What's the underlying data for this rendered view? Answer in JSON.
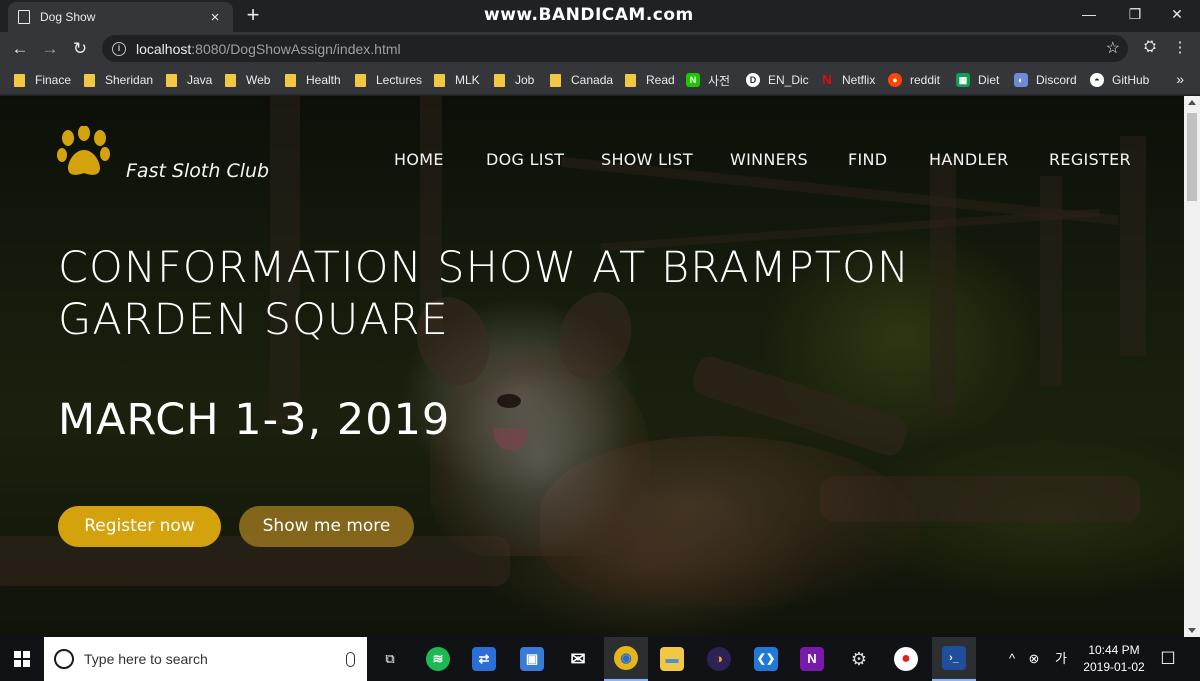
{
  "browser": {
    "tab_title": "Dog Show",
    "tab_close": "×",
    "new_tab": "+",
    "watermark": "www.BANDICAM.com",
    "window_controls": {
      "minimize": "—",
      "restore": "❐",
      "close": "✕"
    },
    "nav": {
      "back": "←",
      "forward": "→",
      "reload": "↻"
    },
    "url_host": "localhost",
    "url_rest": ":8080/DogShowAssign/index.html",
    "star": "☆",
    "menu": "⋮",
    "bookmarks": [
      {
        "label": "Finace",
        "type": "folder"
      },
      {
        "label": "Sheridan",
        "type": "folder"
      },
      {
        "label": "Java",
        "type": "folder"
      },
      {
        "label": "Web",
        "type": "folder"
      },
      {
        "label": "Health",
        "type": "folder"
      },
      {
        "label": "Lectures",
        "type": "folder"
      },
      {
        "label": "MLK",
        "type": "folder"
      },
      {
        "label": "Job",
        "type": "folder"
      },
      {
        "label": "Canada",
        "type": "folder"
      },
      {
        "label": "Read",
        "type": "folder"
      },
      {
        "label": "사전",
        "type": "site",
        "color": "#1ec800"
      },
      {
        "label": "EN_Dic",
        "type": "site",
        "color": "#ffffff"
      },
      {
        "label": "Netflix",
        "type": "site",
        "color": "#e50914"
      },
      {
        "label": "reddit",
        "type": "site",
        "color": "#ff4500"
      },
      {
        "label": "Diet",
        "type": "site",
        "color": "#0f9d58"
      },
      {
        "label": "Discord",
        "type": "site",
        "color": "#7289da"
      },
      {
        "label": "GitHub",
        "type": "site",
        "color": "#ffffff"
      }
    ],
    "bookmarks_more": "»"
  },
  "page": {
    "brand": "Fast Sloth Club",
    "accent_color": "#d4a20c",
    "nav_items": [
      "HOME",
      "DOG LIST",
      "SHOW LIST",
      "WINNERS",
      "FIND",
      "HANDLER",
      "REGISTER"
    ],
    "headline_line1": "CONFORMATION SHOW AT BRAMPTON",
    "headline_line2": "GARDEN SQUARE",
    "date": "MARCH 1-3, 2019",
    "primary_button": "Register now",
    "secondary_button": "Show me more"
  },
  "taskbar": {
    "search_placeholder": "Type here to search",
    "apps": [
      {
        "name": "task-view",
        "glyph": "⧉",
        "color": "transparent"
      },
      {
        "name": "spotify",
        "glyph": "≋",
        "color": "#1db954"
      },
      {
        "name": "network",
        "glyph": "⇄",
        "color": "#2b6fd6"
      },
      {
        "name": "remote",
        "glyph": "▣",
        "color": "#3a7bd5"
      },
      {
        "name": "mail",
        "glyph": "✉",
        "color": "transparent"
      },
      {
        "name": "chrome",
        "glyph": "◉",
        "color": "#e4b61a"
      },
      {
        "name": "file-explorer",
        "glyph": "▬",
        "color": "#f2c744"
      },
      {
        "name": "eclipse",
        "glyph": "◑",
        "color": "#2c2255"
      },
      {
        "name": "vscode",
        "glyph": "❮❯",
        "color": "#1e7ad6"
      },
      {
        "name": "onenote",
        "glyph": "N",
        "color": "#7719aa"
      },
      {
        "name": "settings",
        "glyph": "⚙",
        "color": "transparent"
      },
      {
        "name": "bandicam",
        "glyph": "●",
        "color": "#d22"
      },
      {
        "name": "powershell",
        "glyph": "›_",
        "color": "#1f4e9c"
      }
    ],
    "tray_up": "^",
    "time": "10:44 PM",
    "date": "2019-01-02",
    "notification": "☐"
  }
}
